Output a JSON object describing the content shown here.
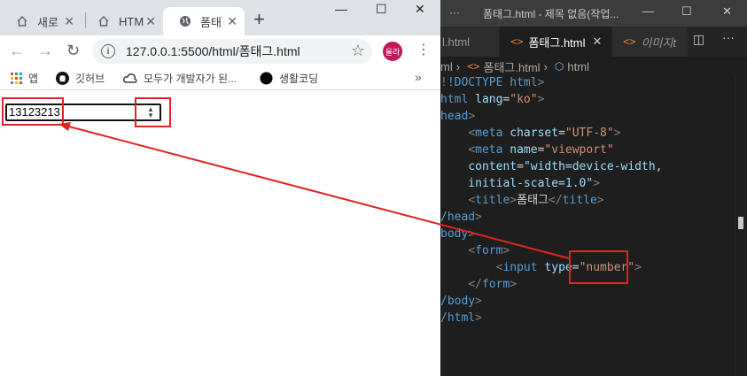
{
  "browser": {
    "tabs": [
      {
        "label": "새로"
      },
      {
        "label": "HTM"
      },
      {
        "label": "폼태"
      }
    ],
    "address": "127.0.0.1:5500/html/폼태그.html",
    "avatar_text": "올라",
    "bookmarks": [
      {
        "label": "앱"
      },
      {
        "label": "깃허브"
      },
      {
        "label": "모두가 개발자가 된..."
      },
      {
        "label": "생활코딩"
      }
    ]
  },
  "page": {
    "number_input_value": "13123213"
  },
  "editor": {
    "window_title": "폼태그.html - 제목 없음(작업...",
    "tabs": [
      {
        "label": "l.html"
      },
      {
        "label": "폼태그.html"
      },
      {
        "label": "이미지t"
      }
    ],
    "breadcrumb": {
      "root": "ml",
      "file": "폼태그.html",
      "node": "html"
    },
    "code_lines": [
      "!DOCTYPE html>",
      "html lang=\"ko\">",
      "head>",
      "    <meta charset=\"UTF-8\">",
      "    <meta name=\"viewport\"",
      "    content=\"width=device-width,",
      "    initial-scale=1.0\">",
      "    <title>폼태그</title>",
      "/head>",
      "body>",
      "    <form>",
      "        <input type=\"number\">",
      "    </form>",
      "/body>",
      "/html>"
    ]
  },
  "colors": {
    "annotation_red": "#e02424",
    "vscode_bg": "#1e1e1e",
    "chrome_tabstrip": "#dee1e6"
  }
}
